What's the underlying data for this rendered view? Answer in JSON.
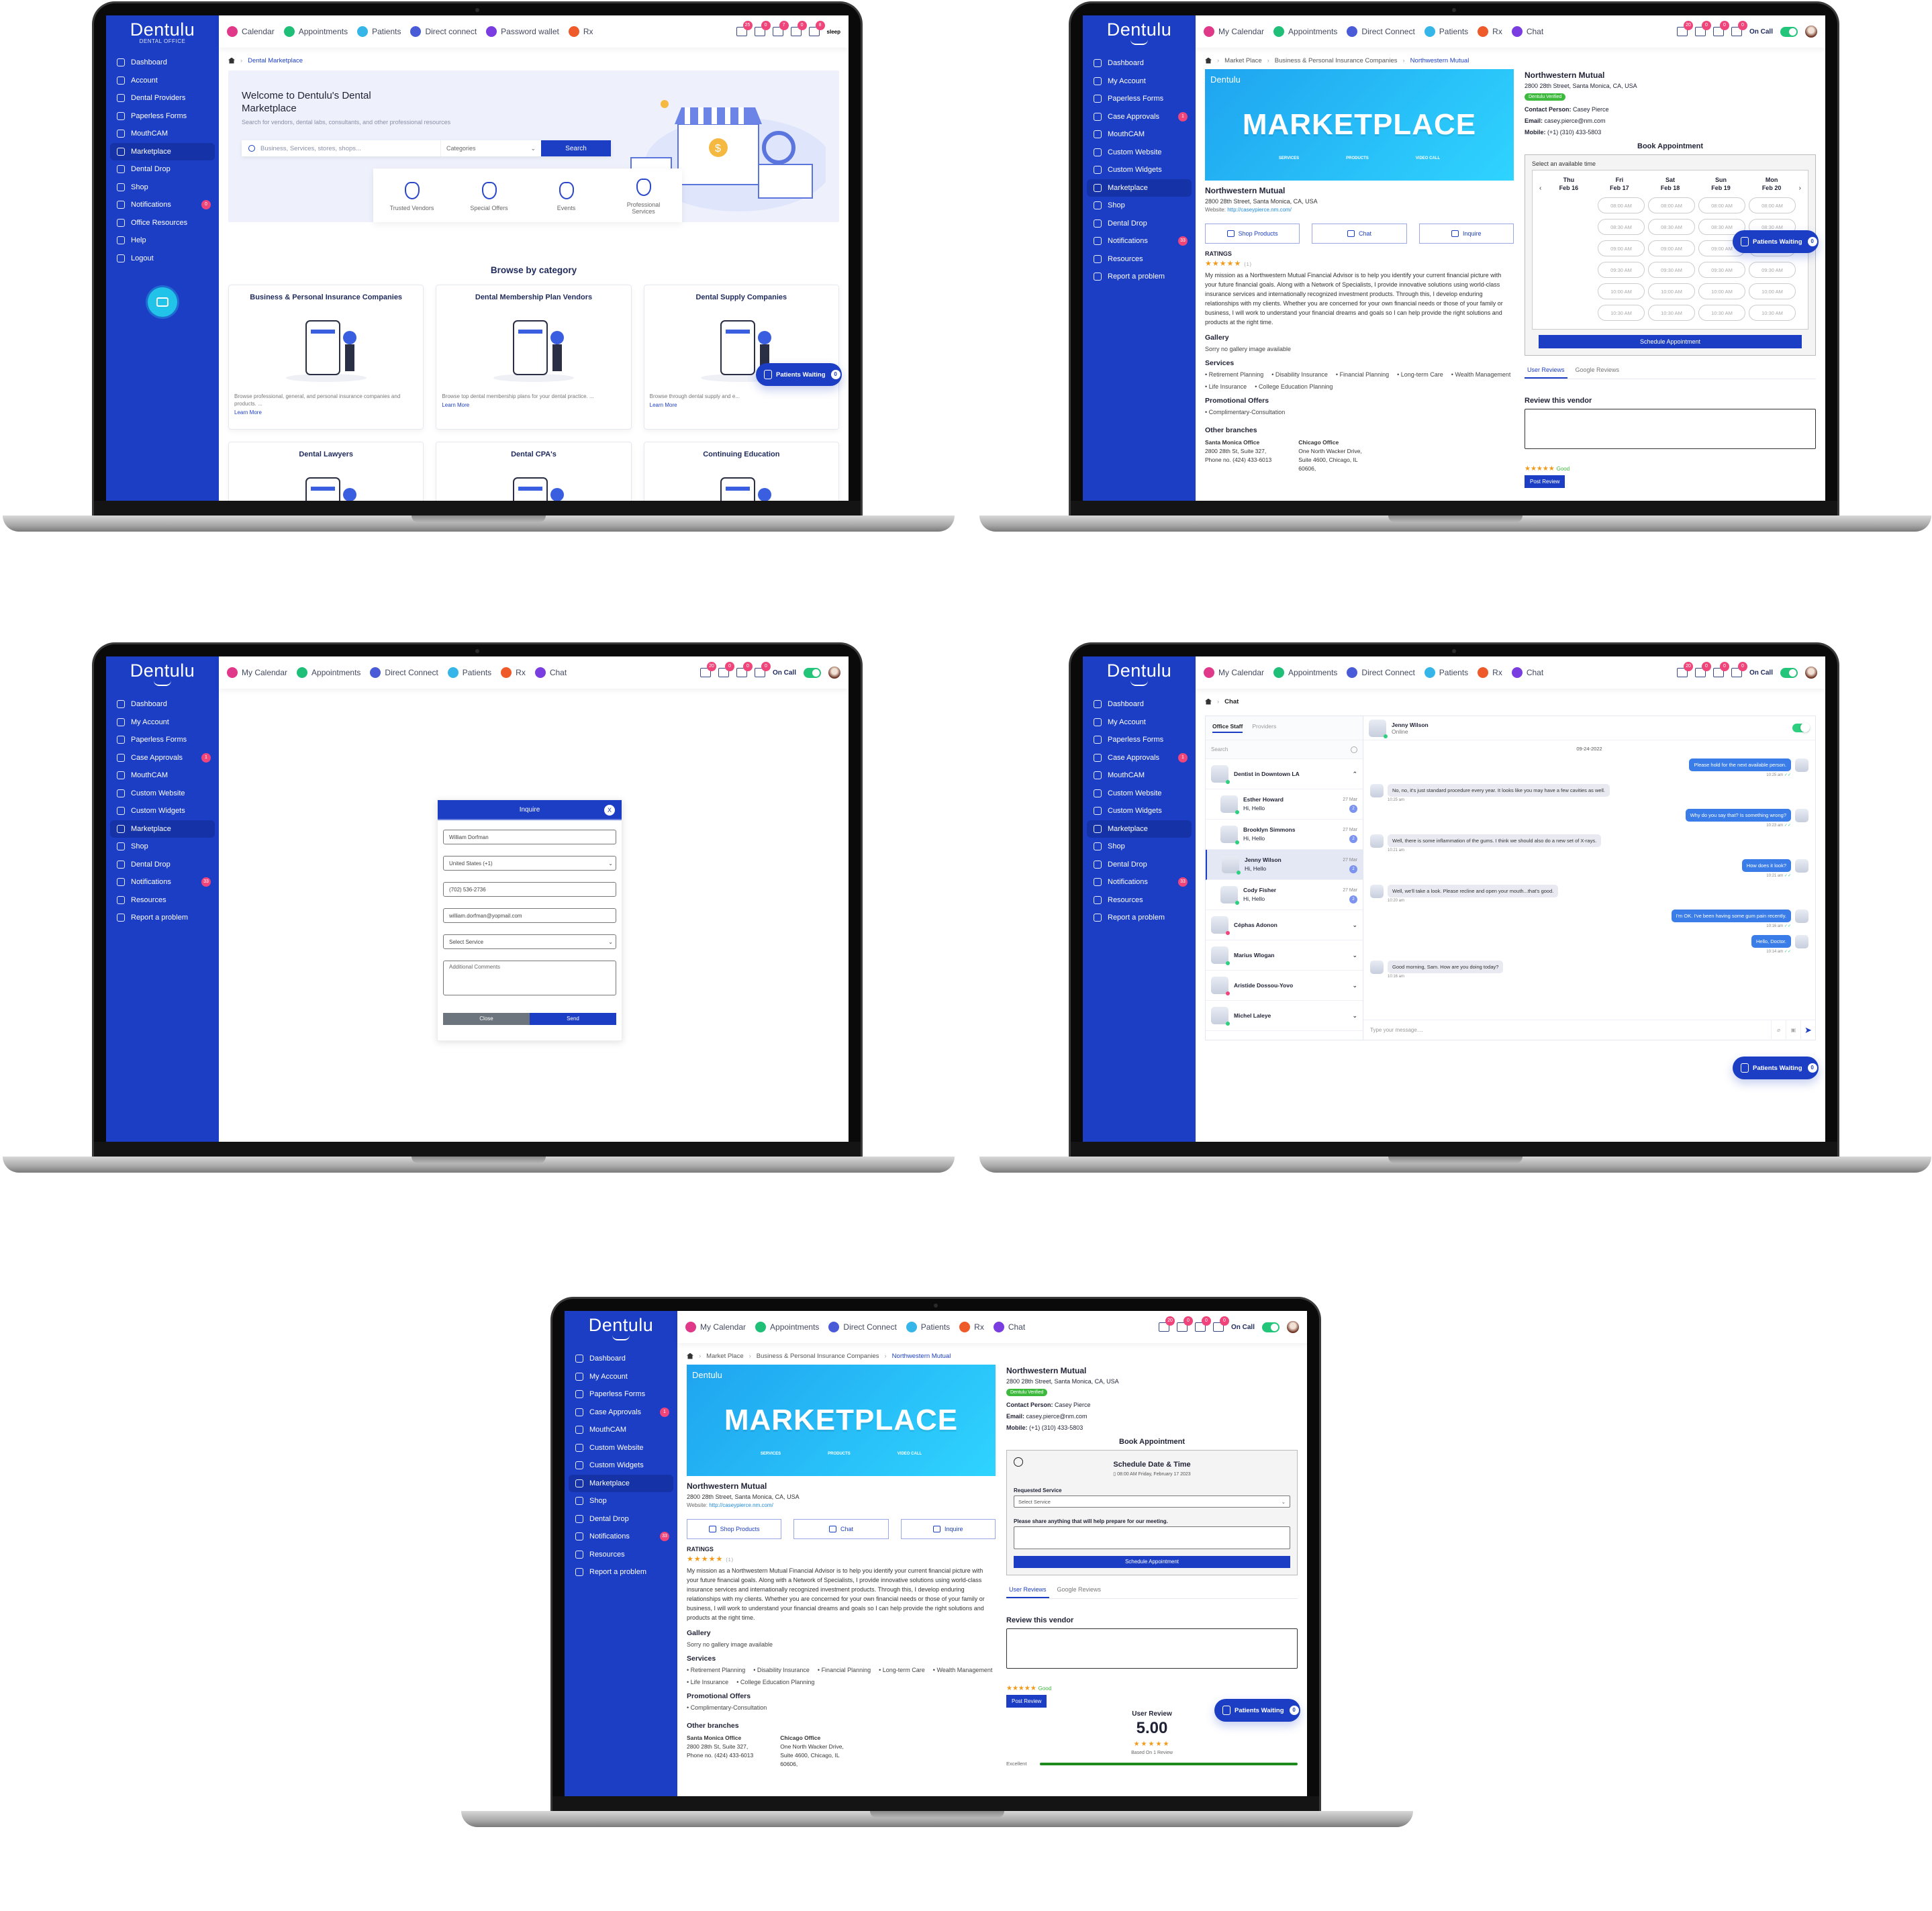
{
  "brand": {
    "name": "Dentulu",
    "subtitle": "DENTAL OFFICE",
    "marketplace_sub": "MARKETPLACE",
    "colors": {
      "primary": "#1c3ec5",
      "badge": "#f0457a",
      "verified": "#3dba3d",
      "star": "#f19a1a",
      "chat_out": "#3a7de8"
    }
  },
  "screen1": {
    "sidebar": [
      {
        "label": "Dashboard",
        "icon": "dashboard-icon"
      },
      {
        "label": "Account",
        "icon": "account-icon"
      },
      {
        "label": "Dental Providers",
        "icon": "providers-icon"
      },
      {
        "label": "Paperless Forms",
        "icon": "forms-icon"
      },
      {
        "label": "MouthCAM",
        "icon": "mouthcam-icon"
      },
      {
        "label": "Marketplace",
        "icon": "marketplace-icon",
        "active": true
      },
      {
        "label": "Dental Drop",
        "icon": "dental-drop-icon"
      },
      {
        "label": "Shop",
        "icon": "shop-icon"
      },
      {
        "label": "Notifications",
        "icon": "bell-icon",
        "badge": "0"
      },
      {
        "label": "Office Resources",
        "icon": "resources-icon"
      },
      {
        "label": "Help",
        "icon": "help-icon"
      },
      {
        "label": "Logout",
        "icon": "logout-icon"
      }
    ],
    "topnav": [
      {
        "label": "Calendar",
        "color": "#e0398a"
      },
      {
        "label": "Appointments",
        "color": "#1fbf78"
      },
      {
        "label": "Patients",
        "color": "#36b6e8"
      },
      {
        "label": "Direct connect",
        "color": "#4a5bd8"
      },
      {
        "label": "Password wallet",
        "color": "#7a3de0"
      },
      {
        "label": "Rx",
        "color": "#ef5a2a"
      }
    ],
    "header_badges": [
      "25",
      "0",
      "7",
      "0",
      "8"
    ],
    "user_label": "sleep",
    "breadcrumb": "Dental Marketplace",
    "hero": {
      "title": "Welcome to Dentulu's Dental Marketplace",
      "subtitle": "Search for vendors, dental labs, consultants, and other professional resources",
      "search_placeholder": "Business, Services, stores, shops...",
      "category_select": "Categories",
      "search_button": "Search"
    },
    "quick_links": [
      "Trusted Vendors",
      "Special Offers",
      "Events",
      "Professional Services"
    ],
    "browse_title": "Browse by category",
    "categories": [
      {
        "title": "Business & Personal Insurance Companies",
        "desc": "Browse professional, general, and personal insurance companies and products. ...",
        "link": "Learn More"
      },
      {
        "title": "Dental Membership Plan Vendors",
        "desc": "Browse top dental membership plans for your dental practice. ...",
        "link": "Learn More"
      },
      {
        "title": "Dental Supply Companies",
        "desc": "Browse through dental supply and e...",
        "link": "Learn More"
      },
      {
        "title": "Dental Lawyers",
        "desc": "",
        "link": ""
      },
      {
        "title": "Dental CPA's",
        "desc": "",
        "link": ""
      },
      {
        "title": "Continuing Education",
        "desc": "",
        "link": ""
      }
    ],
    "patients_waiting": {
      "label": "Patients Waiting",
      "count": "0"
    }
  },
  "common": {
    "sidebar": [
      {
        "label": "Dashboard",
        "icon": "dashboard-icon"
      },
      {
        "label": "My Account",
        "icon": "account-icon"
      },
      {
        "label": "Paperless Forms",
        "icon": "forms-icon"
      },
      {
        "label": "Case Approvals",
        "icon": "case-approvals-icon",
        "badge": "1"
      },
      {
        "label": "MouthCAM",
        "icon": "mouthcam-icon"
      },
      {
        "label": "Custom Website",
        "icon": "website-icon"
      },
      {
        "label": "Custom Widgets",
        "icon": "widgets-icon"
      },
      {
        "label": "Marketplace",
        "icon": "marketplace-icon",
        "active": true
      },
      {
        "label": "Shop",
        "icon": "shop-icon"
      },
      {
        "label": "Dental Drop",
        "icon": "dental-drop-icon"
      },
      {
        "label": "Notifications",
        "icon": "bell-icon",
        "badge": "33"
      },
      {
        "label": "Resources",
        "icon": "resources-icon"
      },
      {
        "label": "Report a problem",
        "icon": "warning-icon"
      }
    ],
    "topnav": [
      {
        "label": "My Calendar",
        "color": "#e0398a"
      },
      {
        "label": "Appointments",
        "color": "#1fbf78"
      },
      {
        "label": "Direct Connect",
        "color": "#4a5bd8"
      },
      {
        "label": "Patients",
        "color": "#36b6e8"
      },
      {
        "label": "Rx",
        "color": "#ef5a2a"
      },
      {
        "label": "Chat",
        "color": "#7a3de0"
      }
    ],
    "header_badges": [
      "20",
      "0",
      "0",
      "0"
    ],
    "on_call_label": "On Call",
    "on_call_enabled": true,
    "patients_waiting": {
      "label": "Patients Waiting",
      "count": "0"
    }
  },
  "vendor": {
    "breadcrumb": [
      "Market Place",
      "Business & Personal Insurance Companies",
      "Northwestern Mutual"
    ],
    "banner_word": "MARKETPLACE",
    "banner_tags": [
      "SERVICES",
      "PRODUCTS",
      "VIDEO CALL"
    ],
    "name": "Northwestern Mutual",
    "address": "2800 28th Street, Santa Monica, CA, USA",
    "website_label": "Website:",
    "website": "http://caseypierce.nm.com/",
    "buttons": [
      "Shop Products",
      "Chat",
      "Inquire"
    ],
    "ratings_label": "RATINGS",
    "rating_stars": 5,
    "rating_count": "(1)",
    "mission": "My mission as a Northwestern Mutual Financial Advisor is to help you identify your current financial picture with your future financial goals. Along with a Network of Specialists, I provide innovative solutions using world-class insurance services and internationally recognized investment products. Through this, I develop enduring relationships with my clients. Whether you are concerned for your own financial needs or those of your family or business, I will work to understand your financial dreams and goals so I can help provide the right solutions and products at the right time.",
    "gallery_title": "Gallery",
    "gallery_text": "Sorry no gallery image available",
    "services_title": "Services",
    "services": [
      "Retirement Planning",
      "Disability Insurance",
      "Financial Planning",
      "Long-term Care",
      "Wealth Management",
      "Life Insurance",
      "College Education Planning"
    ],
    "promo_title": "Promotional Offers",
    "promos": [
      "Complimentary-Consultation"
    ],
    "branches_title": "Other branches",
    "branches": [
      {
        "name": "Santa Monica Office",
        "lines": [
          "2800 28th St, Suite 327,",
          "Phone no. (424) 433-6013"
        ]
      },
      {
        "name": "Chicago Office",
        "lines": [
          "One North Wacker Drive,",
          "Suite 4600, Chicago, IL",
          "60606,"
        ]
      }
    ],
    "verified_label": "Dentulu Verified",
    "contact_label": "Contact Person:",
    "contact": "Casey Pierce",
    "email_label": "Email:",
    "email": "casey.pierce@nm.com",
    "mobile_label": "Mobile:",
    "mobile": "(+1) (310) 433-5803",
    "book_title": "Book Appointment",
    "select_time_label": "Select an available time",
    "days": [
      {
        "dow": "Thu",
        "date": "Feb 16"
      },
      {
        "dow": "Fri",
        "date": "Feb 17"
      },
      {
        "dow": "Sat",
        "date": "Feb 18"
      },
      {
        "dow": "Sun",
        "date": "Feb 19"
      },
      {
        "dow": "Mon",
        "date": "Feb 20"
      }
    ],
    "times": [
      "08:00 AM",
      "08:30 AM",
      "09:00 AM",
      "09:30 AM",
      "10:00 AM",
      "10:30 AM"
    ],
    "schedule_button": "Schedule Appointment",
    "review_tabs": [
      "User Reviews",
      "Google Reviews"
    ],
    "review_title": "Review this vendor",
    "review_rating_text": "Good",
    "post_review": "Post Review",
    "schedule_form": {
      "title": "Schedule Date & Time",
      "selected": "08:00 AM Friday, February 17 2023",
      "service_label": "Requested Service",
      "service_value": "Select Service",
      "notes_label": "Please share anything that will help prepare for our meeting.",
      "submit": "Schedule Appointment"
    },
    "user_review": {
      "title": "User Review",
      "score": "5.00",
      "based_on": "Based On 1 Review",
      "bars": [
        {
          "label": "Excellent",
          "fraction": 1.0
        }
      ]
    }
  },
  "inquire": {
    "title": "Inquire",
    "close_icon": "X",
    "name": "William Dorfman",
    "country": "United States (+1)",
    "phone": "(702) 536-2736",
    "email": "william.dorfman@yopmail.com",
    "service": "Select Service",
    "comments_placeholder": "Additional Comments",
    "close_button": "Close",
    "send_button": "Send"
  },
  "chat": {
    "breadcrumb": "Chat",
    "tabs": [
      "Office Staff",
      "Providers"
    ],
    "search_placeholder": "Search",
    "groups": [
      {
        "name": "Dentist in Downtown LA",
        "expanded": true,
        "members": [
          {
            "name": "Esther Howard",
            "preview": "Hi, Hello",
            "date": "27 Mar",
            "count": "2"
          },
          {
            "name": "Brooklyn Simmons",
            "preview": "Hi, Hello",
            "date": "27 Mar",
            "count": "2"
          },
          {
            "name": "Jenny Wilson",
            "preview": "Hi, Hello",
            "date": "27 Mar",
            "count": "2",
            "selected": true
          },
          {
            "name": "Cody Fisher",
            "preview": "Hi, Hello",
            "date": "27 Mar",
            "count": "2"
          }
        ]
      },
      {
        "name": "Céphas Adonon",
        "status": "offline"
      },
      {
        "name": "Marius Wlogan",
        "status": "online"
      },
      {
        "name": "Aristide Dossou-Yovo",
        "status": "offline"
      },
      {
        "name": "Michel Laleye",
        "status": "online"
      }
    ],
    "contact": {
      "name": "Jenny Wilson",
      "status": "Online"
    },
    "date": "09-24-2022",
    "messages": [
      {
        "dir": "out",
        "text": "Please hold for the next available person.",
        "time": "10:25 am"
      },
      {
        "dir": "in",
        "text": "No, no, it's just standard procedure every year. It looks like you may have a few cavities as well.",
        "time": "10:25 am"
      },
      {
        "dir": "out",
        "text": "Why do you say that? Is something wrong?",
        "time": "10:23 am"
      },
      {
        "dir": "in",
        "text": "Well, there is some inflammation of the gums. I think we should also do a new set of X-rays.",
        "time": "10:21 am"
      },
      {
        "dir": "out",
        "text": "How does it look?",
        "time": "10:21 am"
      },
      {
        "dir": "in",
        "text": "Well, we'll take a look. Please recline and open your mouth...that's good.",
        "time": "10:20 am"
      },
      {
        "dir": "out",
        "text": "I'm OK. I've been having some gum pain recently.",
        "time": "10:16 am"
      },
      {
        "dir": "out",
        "text": "Hello, Doctor.",
        "time": "10:14 am"
      },
      {
        "dir": "in",
        "text": "Good morning, Sam. How are you doing today?",
        "time": "10:16 am"
      }
    ],
    "input_placeholder": "Type your message...."
  }
}
